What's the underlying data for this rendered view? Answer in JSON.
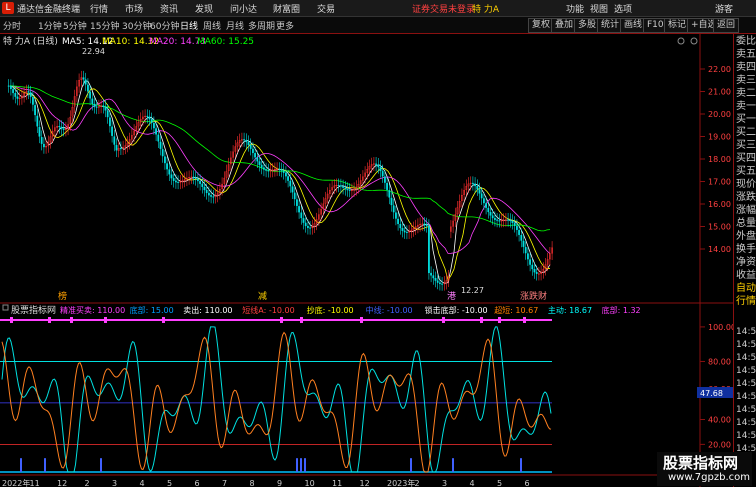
{
  "titlebar": {
    "app_name": "通达信金融终端",
    "menus": [
      "行情",
      "市场",
      "资讯",
      "发现",
      "问小达",
      "财富圈",
      "交易"
    ],
    "login_notice": "证券交易未登录",
    "stock_name": "特 力A",
    "right_menus": [
      "功能",
      "视图",
      "选项",
      "游客"
    ]
  },
  "periodbar": {
    "periods": [
      "分时",
      "1分钟",
      "5分钟",
      "15分钟",
      "30分钟",
      "60分钟",
      "日线",
      "周线",
      "月线",
      "多周期",
      "更多"
    ],
    "active": "日线",
    "tools": [
      "复权",
      "叠加",
      "多股",
      "统计",
      "画线",
      "F10",
      "标记",
      "+自选",
      "返回"
    ]
  },
  "main_chart": {
    "stock_label": "特 力A (日线)",
    "ma": [
      {
        "label": "MA5: 14.12",
        "color": "#ffffff"
      },
      {
        "label": "MA10: 14.32",
        "color": "#ffff00"
      },
      {
        "label": "MA20: 14.73",
        "color": "#ff40ff"
      },
      {
        "label": "MA60: 15.25",
        "color": "#00ff00"
      }
    ],
    "price_ticks": [
      "22.00",
      "21.00",
      "20.00",
      "19.00",
      "18.00",
      "17.00",
      "16.00",
      "15.00",
      "14.00"
    ],
    "high_label": "22.94",
    "low_label": "12.27",
    "event_marks": [
      {
        "text": "榜",
        "color": "#ffa000"
      },
      {
        "text": "减",
        "color": "#ffd000"
      },
      {
        "text": "港",
        "color": "#ff80ff"
      },
      {
        "text": "涨跌财",
        "color": "#ff8080"
      }
    ]
  },
  "indicator": {
    "name": "股票指标网",
    "params": [
      {
        "label": "精准买卖: 110.00",
        "color": "#ff40ff"
      },
      {
        "label": "底部: 15.00",
        "color": "#00a0ff"
      },
      {
        "label": "卖出: 110.00",
        "color": "#ffffff"
      },
      {
        "label": "短线A: -10.00",
        "color": "#ff4040"
      },
      {
        "label": "抄底: -10.00",
        "color": "#ffff00"
      },
      {
        "label": "中线: -10.00",
        "color": "#4060ff"
      },
      {
        "label": "锁击底部: -10.00",
        "color": "#ffffff"
      },
      {
        "label": "超短: 10.67",
        "color": "#ff8000"
      },
      {
        "label": "主动: 18.67",
        "color": "#00ffff"
      },
      {
        "label": "底部: 1.32",
        "color": "#ff40ff"
      }
    ],
    "ticks": [
      "100.00",
      "80.00",
      "60.00",
      "40.00",
      "20.00"
    ],
    "current_value": "47.68",
    "date_labels": [
      "2022年",
      "11",
      "12",
      "2",
      "3",
      "4",
      "5",
      "6",
      "7",
      "8",
      "9",
      "10",
      "11",
      "12",
      "2023年",
      "2",
      "3",
      "4",
      "5",
      "6"
    ]
  },
  "rightpanel": [
    "委比",
    "卖五",
    "卖四",
    "卖三",
    "卖二",
    "卖一",
    "买一",
    "买二",
    "买三",
    "买四",
    "买五",
    "现价",
    "涨跌",
    "涨幅",
    "总量",
    "外盘",
    "换手",
    "净资",
    "收益",
    "自动",
    "行情"
  ],
  "rightpanel_times": [
    "14:5",
    "14:5",
    "14:5",
    "14:5",
    "14:5",
    "14:5",
    "14:5",
    "14:5",
    "14:5",
    "14:5"
  ],
  "watermark": {
    "line1": "股票指标网",
    "line2": "www.7gpzb.com"
  }
}
